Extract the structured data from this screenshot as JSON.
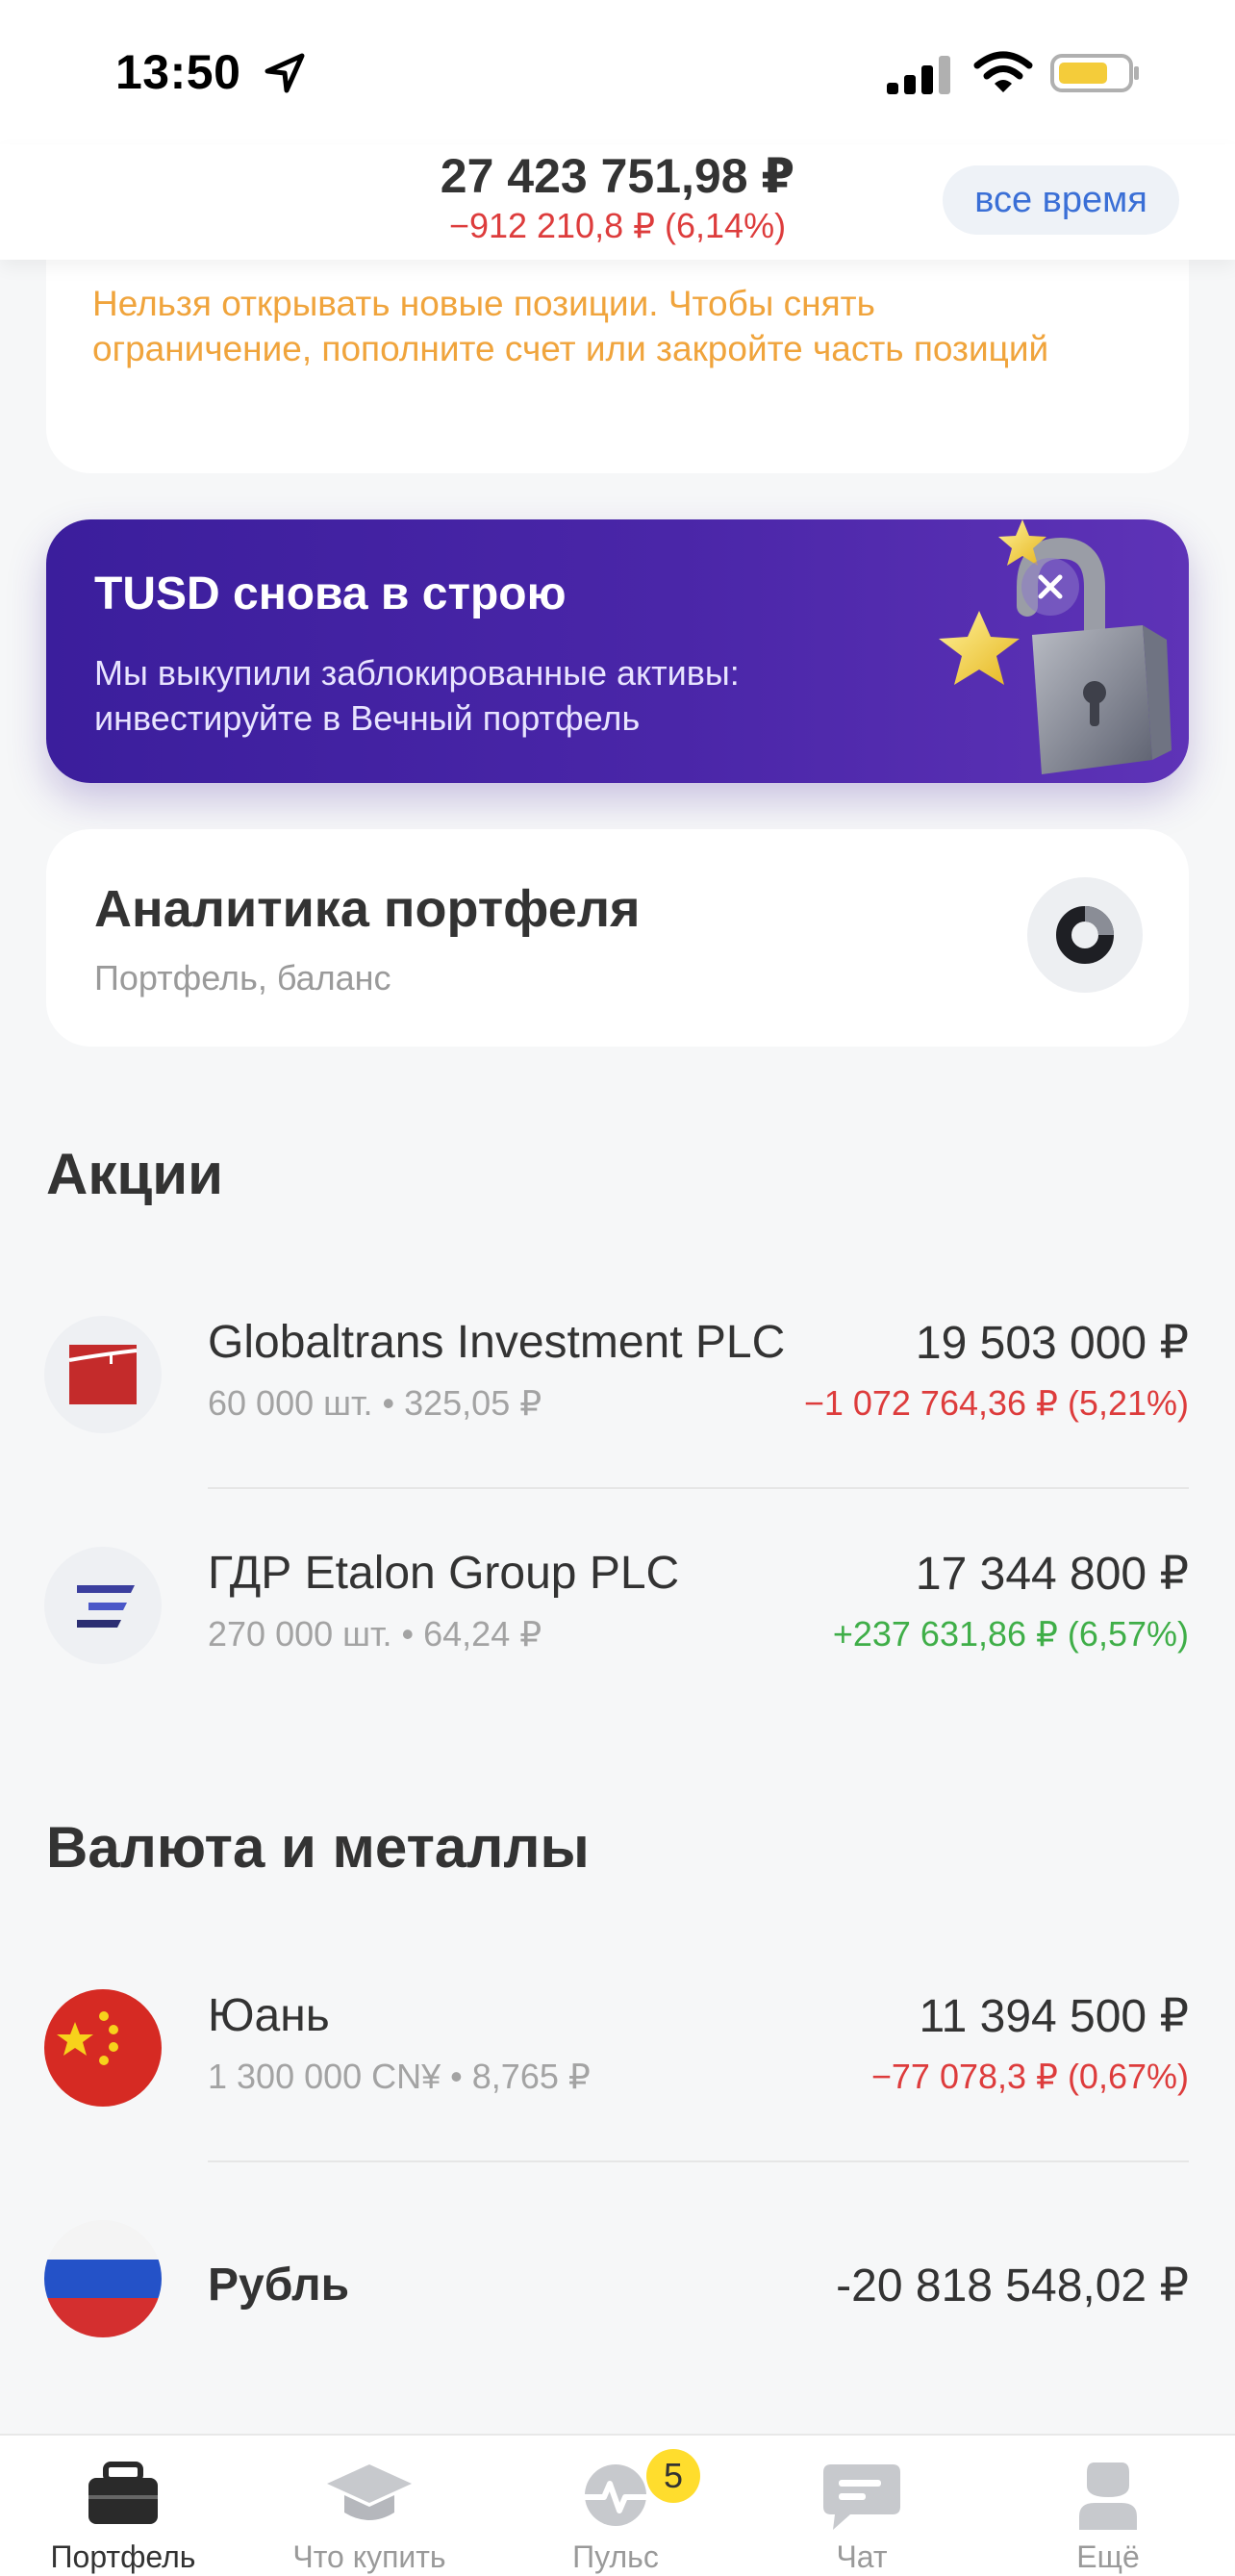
{
  "status_bar": {
    "time": "13:50"
  },
  "header": {
    "total": "27 423 751,98 ₽",
    "delta": "−912 210,8 ₽ (6,14%)",
    "period": "все время"
  },
  "warning": {
    "text": "Нельзя открывать новые позиции. Чтобы снять ограничение, пополните счет или закройте часть позиций"
  },
  "promo": {
    "title": "TUSD снова в строю",
    "text": "Мы выкупили заблокированные активы: инвестируйте в Вечный портфель"
  },
  "analytics": {
    "title": "Аналитика портфеля",
    "subtitle": "Портфель, баланс"
  },
  "sections": {
    "stocks": {
      "title": "Акции",
      "items": [
        {
          "name": "Globaltrans Investment PLC",
          "meta": "60 000 шт. • 325,05 ₽",
          "value": "19 503 000 ₽",
          "change": "−1 072 764,36 ₽ (5,21%)"
        },
        {
          "name": "ГДР Etalon Group PLC",
          "meta": "270 000 шт. • 64,24 ₽",
          "value": "17 344 800 ₽",
          "change": "+237 631,86 ₽ (6,57%)"
        }
      ]
    },
    "currency": {
      "title": "Валюта и металлы",
      "items": [
        {
          "name": "Юань",
          "meta": "1 300 000 CN¥ • 8,765 ₽",
          "value": "11 394 500 ₽",
          "change": "−77 078,3 ₽ (0,67%)"
        },
        {
          "name": "Рубль",
          "value": "-20 818 548,02 ₽"
        }
      ]
    }
  },
  "tabbar": {
    "tabs": [
      {
        "label": "Портфель",
        "icon": "briefcase-icon"
      },
      {
        "label": "Что купить",
        "icon": "graduation-cap-icon"
      },
      {
        "label": "Пульс",
        "icon": "pulse-icon"
      },
      {
        "label": "Чат",
        "icon": "chat-icon"
      },
      {
        "label": "Ещё",
        "icon": "profile-icon"
      }
    ],
    "pulse_badge": "5"
  },
  "colors": {
    "negative": "#dd3c3c",
    "positive": "#3fae48",
    "warning": "#f0a43c",
    "promo_bg": "#4a26a8",
    "accent_link": "#3a6fd6"
  }
}
